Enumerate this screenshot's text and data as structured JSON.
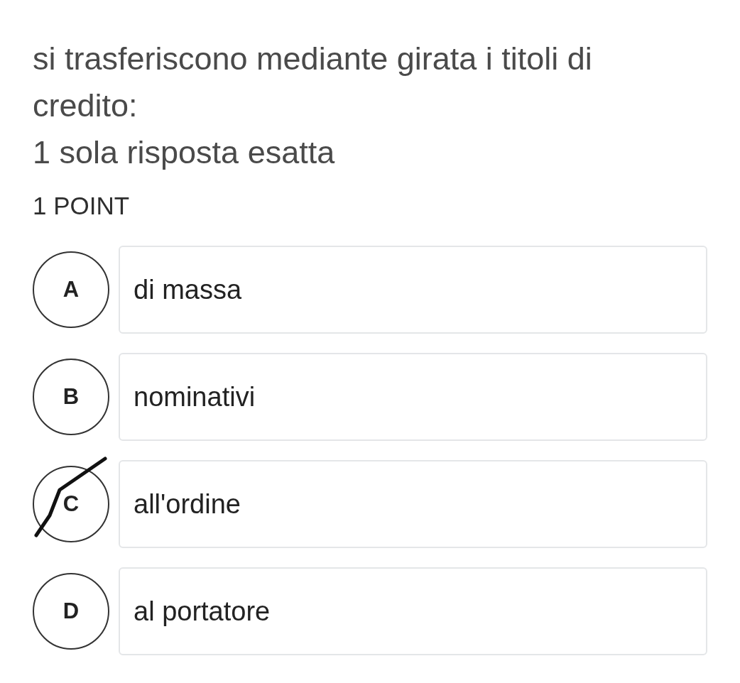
{
  "question": {
    "text": "si trasferiscono mediante girata i titoli di credito:",
    "instruction": "1 sola risposta esatta",
    "points": "1 POINT"
  },
  "options": [
    {
      "letter": "A",
      "text": "di massa",
      "crossed": false
    },
    {
      "letter": "B",
      "text": "nominativi",
      "crossed": false
    },
    {
      "letter": "C",
      "text": "all'ordine",
      "crossed": true
    },
    {
      "letter": "D",
      "text": "al portatore",
      "crossed": false
    }
  ]
}
